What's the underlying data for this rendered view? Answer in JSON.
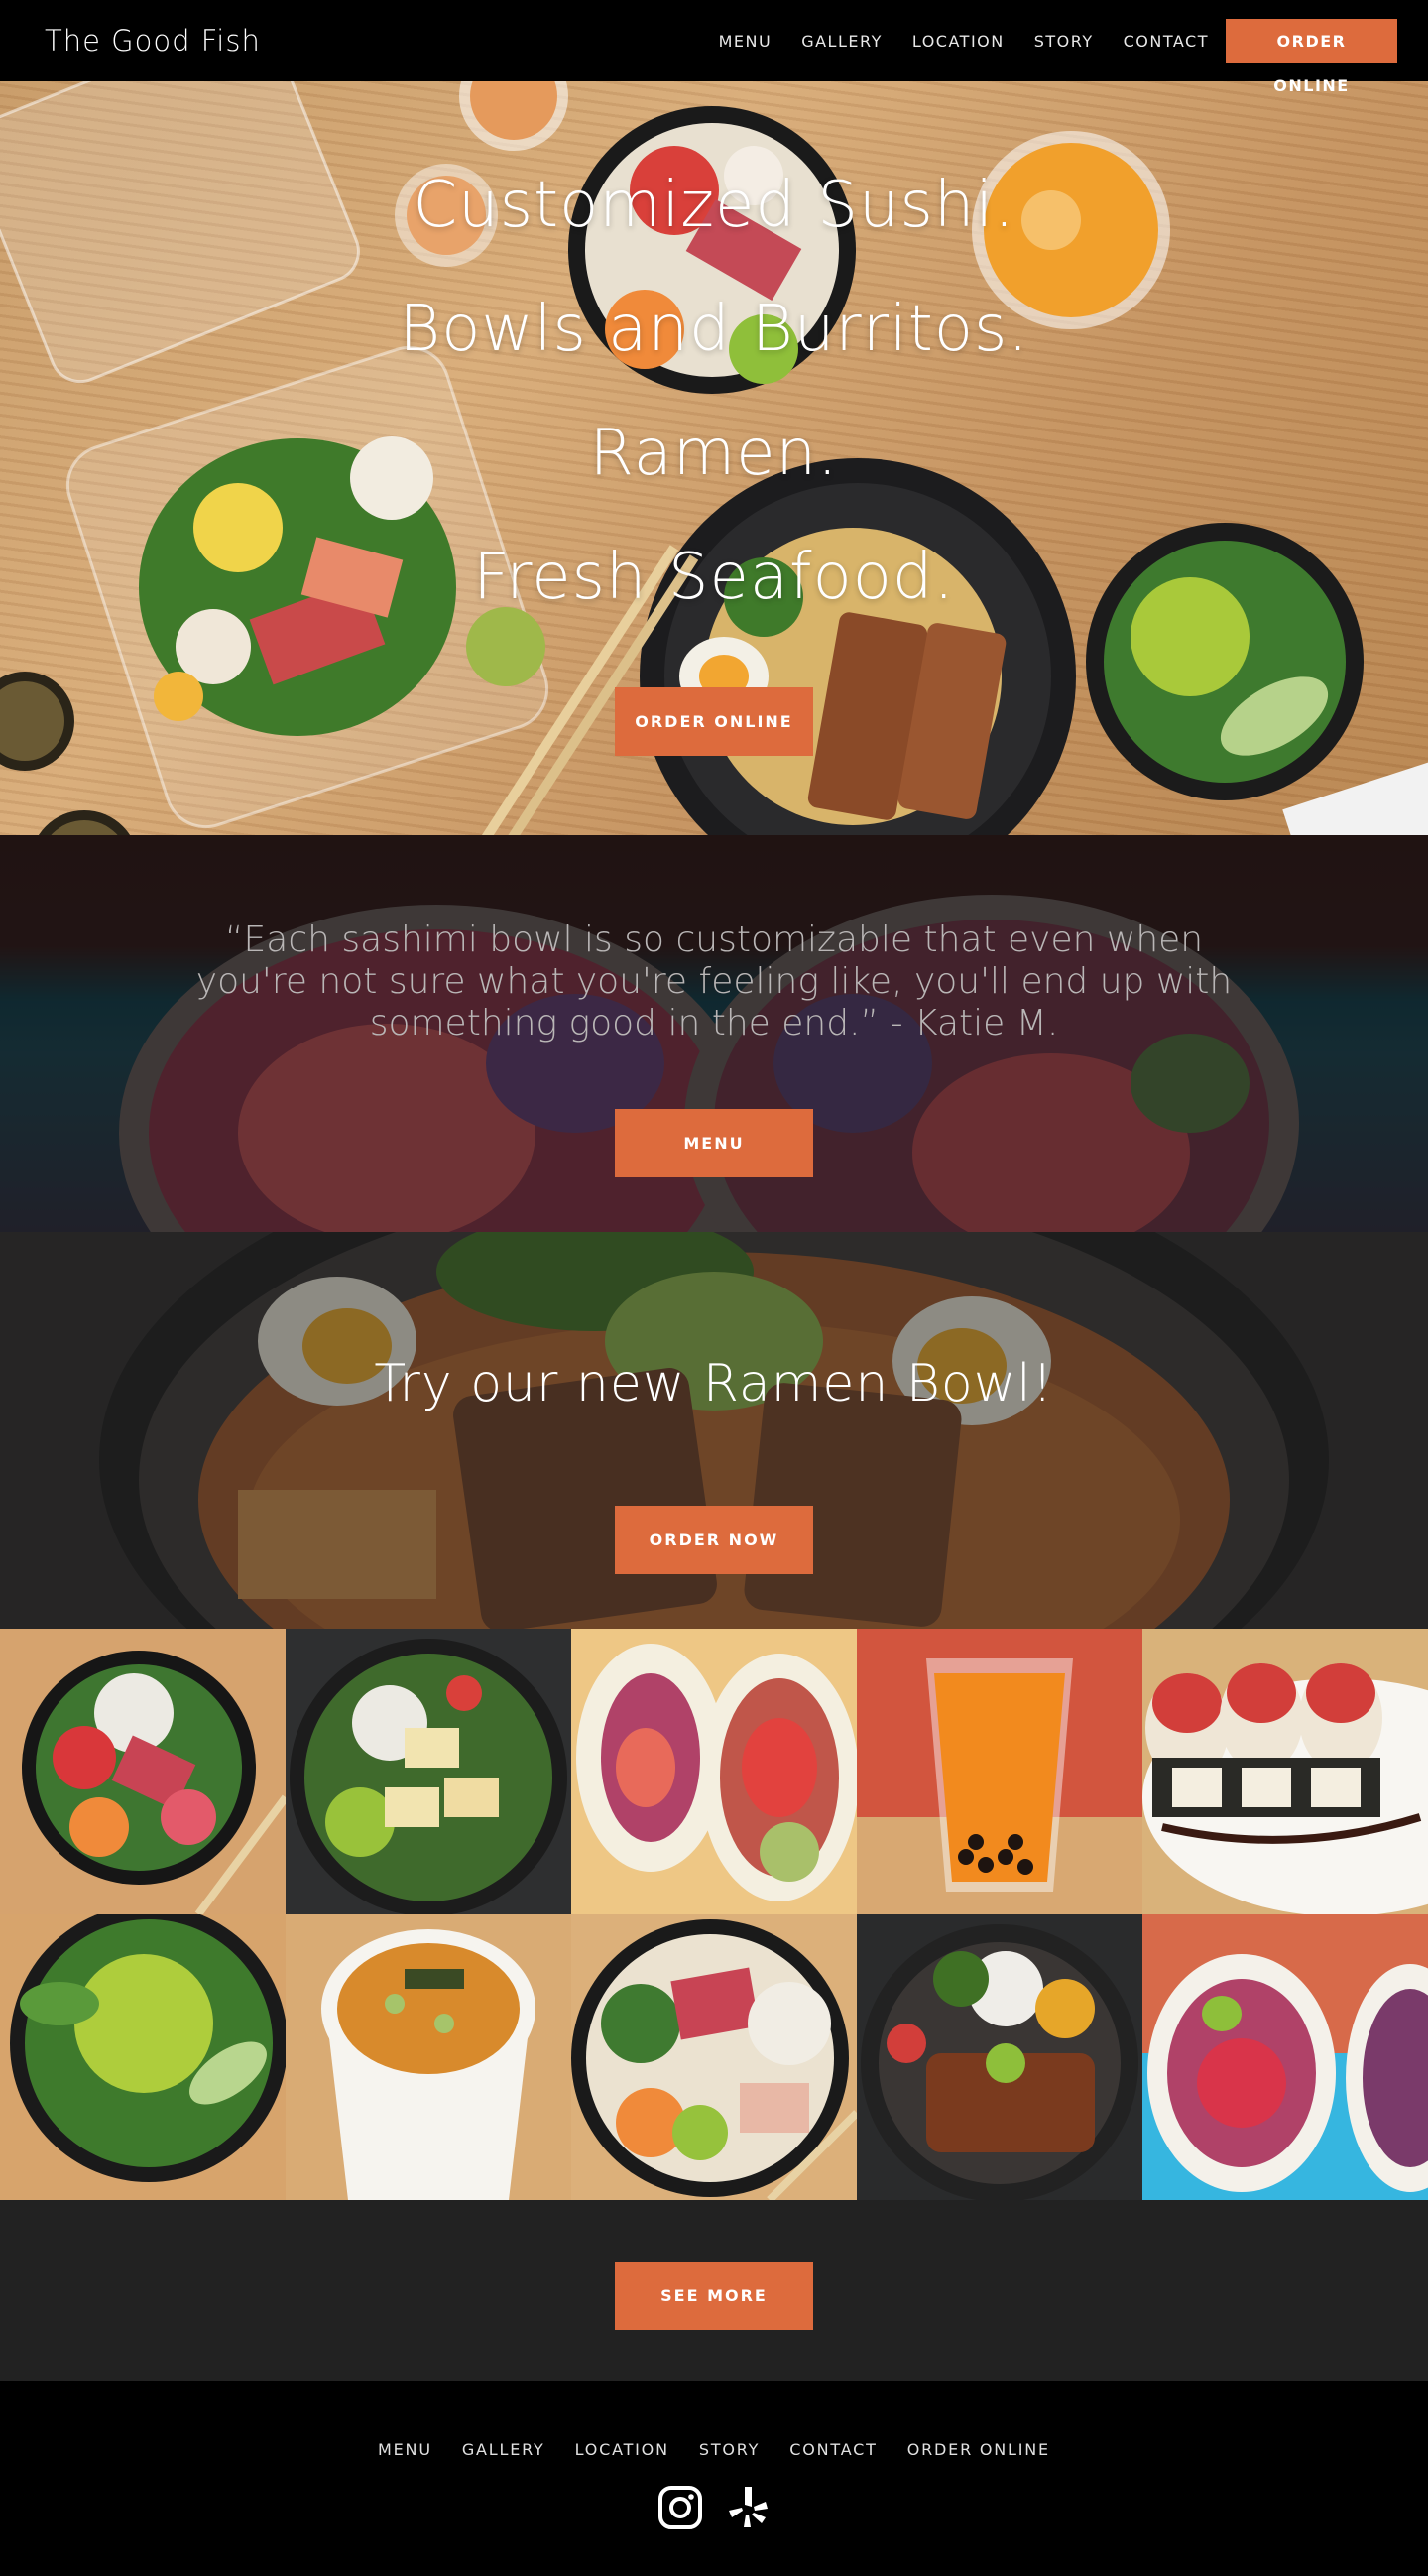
{
  "header": {
    "logo": "The Good Fish",
    "nav": [
      "MENU",
      "GALLERY",
      "LOCATION",
      "STORY",
      "CONTACT"
    ],
    "order_label": "ORDER ONLINE"
  },
  "hero": {
    "lines": [
      "Customized Sushi.",
      "Bowls and Burritos.",
      "Ramen.",
      "Fresh Seafood."
    ],
    "button_label": "ORDER ONLINE"
  },
  "quote": {
    "text": "“Each sashimi bowl is so customizable that even when you're not sure what you're feeling like, you'll end up with something good in the end.” - Katie M.",
    "button_label": "MENU"
  },
  "ramen": {
    "title": "Try our new Ramen Bowl!",
    "button_label": "ORDER NOW"
  },
  "gallery": {
    "tiles": [
      "sashimi-bowl",
      "tofu-salad-bowl",
      "sushi-burrito",
      "thai-iced-tea",
      "spicy-tuna-roll",
      "edamame-salad",
      "miso-soup",
      "poke-bowl",
      "teriyaki-ramen",
      "sushi-burrito-blue"
    ]
  },
  "see_more": {
    "button_label": "SEE MORE"
  },
  "footer": {
    "nav": [
      "MENU",
      "GALLERY",
      "LOCATION",
      "STORY",
      "CONTACT",
      "ORDER ONLINE"
    ],
    "social": [
      "instagram-icon",
      "yelp-icon"
    ]
  },
  "colors": {
    "accent": "#dd6b3d",
    "header_bg": "#000000",
    "footer_bg": "#000000",
    "seemore_bg": "#222222"
  }
}
